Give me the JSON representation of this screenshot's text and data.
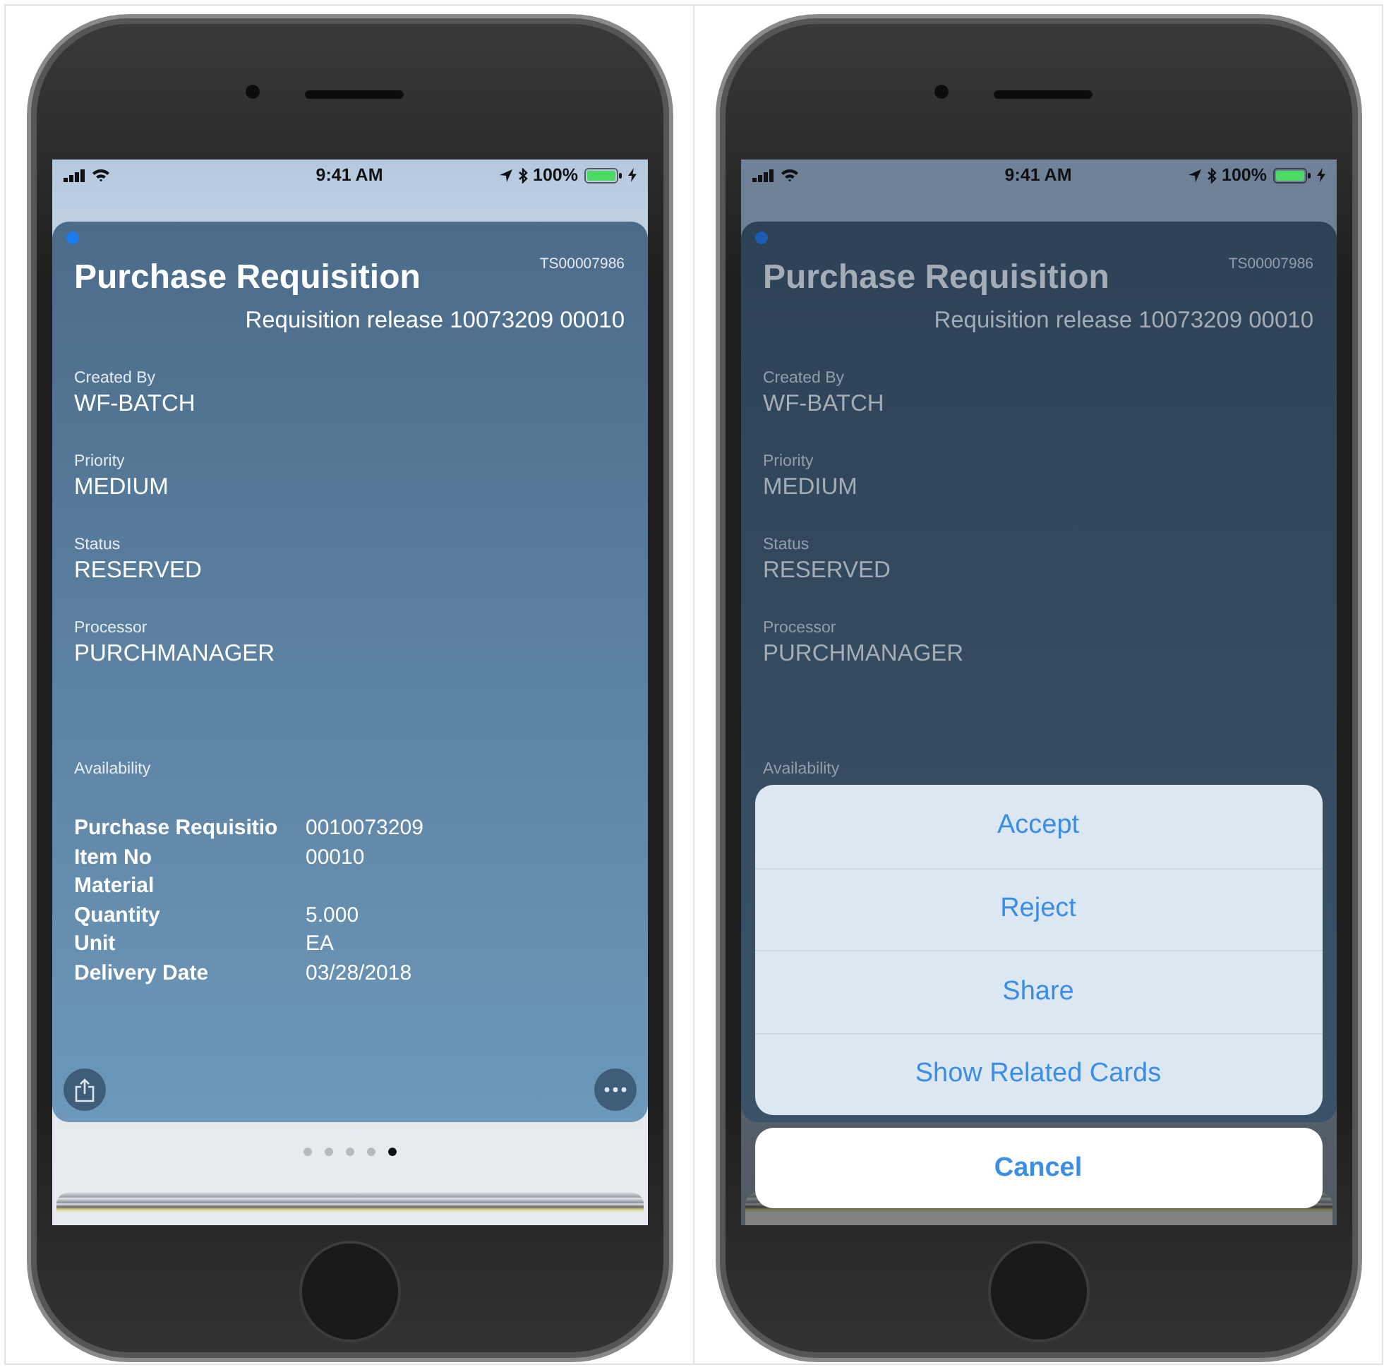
{
  "phones": [
    {
      "dimmed": false,
      "status_bar": {
        "time": "9:41 AM",
        "battery": "100%"
      },
      "card": {
        "unread": true,
        "title": "Purchase Requisition",
        "id": "TS00007986",
        "subtitle": "Requisition release 10073209 00010",
        "fields": [
          {
            "label": "Created By",
            "value": "WF-BATCH"
          },
          {
            "label": "Priority",
            "value": "MEDIUM"
          },
          {
            "label": "Status",
            "value": "RESERVED"
          },
          {
            "label": "Processor",
            "value": "PURCHMANAGER"
          }
        ],
        "section": "Availability",
        "details": [
          {
            "label": "Purchase Requisitio",
            "value": "0010073209"
          },
          {
            "label": "Item No",
            "value": "00010"
          },
          {
            "label": "Material"
          },
          {
            "label": "Quantity",
            "value": "5.000"
          },
          {
            "label": "Unit",
            "value": "EA"
          },
          {
            "label": "Delivery Date",
            "value": "03/28/2018"
          }
        ]
      },
      "page_dots": [
        {
          "selected": false
        },
        {
          "selected": false
        },
        {
          "selected": false
        },
        {
          "selected": false
        },
        {
          "selected": true
        }
      ]
    },
    {
      "dimmed": true,
      "status_bar": {
        "time": "9:41 AM",
        "battery": "100%"
      },
      "card": {
        "unread": true,
        "title": "Purchase Requisition",
        "id": "TS00007986",
        "subtitle": "Requisition release 10073209 00010",
        "fields": [
          {
            "label": "Created By",
            "value": "WF-BATCH"
          },
          {
            "label": "Priority",
            "value": "MEDIUM"
          },
          {
            "label": "Status",
            "value": "RESERVED"
          },
          {
            "label": "Processor",
            "value": "PURCHMANAGER"
          }
        ],
        "section": "Availability"
      },
      "action_sheet": {
        "actions": [
          "Accept",
          "Reject",
          "Share",
          "Show Related Cards"
        ],
        "cancel": "Cancel"
      }
    }
  ]
}
